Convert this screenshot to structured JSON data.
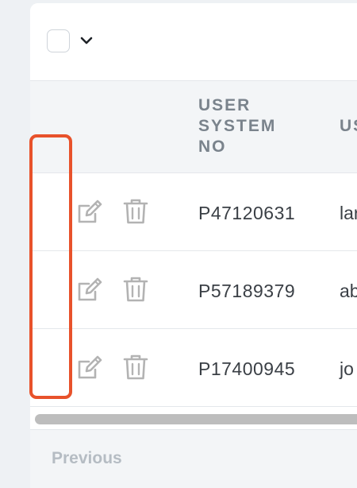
{
  "toolbar": {
    "select_all_icon": "checkbox-empty",
    "dropdown_icon": "chevron-down-icon"
  },
  "table": {
    "columns": [
      {
        "label": "USER\nSYSTEM\nNO"
      },
      {
        "label": "US"
      }
    ],
    "rows": [
      {
        "system_no": "P47120631",
        "user": "lar",
        "actions": [
          "edit-icon",
          "trash-icon"
        ]
      },
      {
        "system_no": "P57189379",
        "user": "ab",
        "actions": [
          "edit-icon",
          "trash-icon"
        ]
      },
      {
        "system_no": "P17400945",
        "user": "jo",
        "actions": [
          "edit-icon",
          "trash-icon"
        ]
      }
    ]
  },
  "pagination": {
    "previous_label": "Previous"
  },
  "colors": {
    "highlight": "#e8522b",
    "header_bg": "#f3f5f7",
    "header_text": "#7a838c",
    "icon_gray": "#b3b3b3"
  }
}
